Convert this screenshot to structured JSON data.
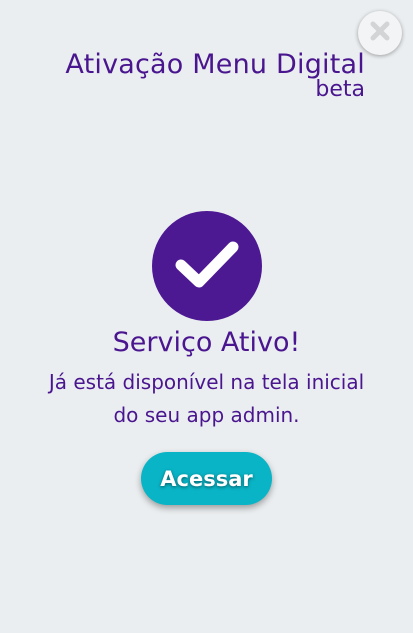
{
  "header": {
    "title": "Ativação Menu Digital",
    "subtitle": "beta"
  },
  "close_button": {
    "icon": "close-icon"
  },
  "status": {
    "icon": "checkmark-icon",
    "title": "Serviço Ativo!",
    "message_line1": "Já está disponível na tela inicial",
    "message_line2": "do seu app admin."
  },
  "action": {
    "label": "Acessar"
  },
  "colors": {
    "background": "#ebeef0",
    "primary_purple": "#4d1993",
    "text_purple": "#4a168f",
    "accent_teal": "#09b4c6"
  }
}
